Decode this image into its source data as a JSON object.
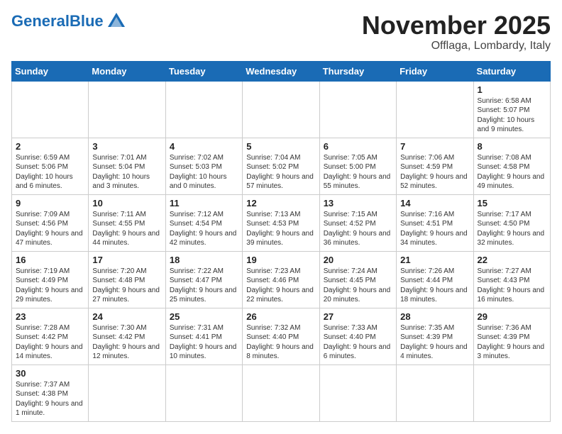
{
  "header": {
    "logo_general": "General",
    "logo_blue": "Blue",
    "month": "November 2025",
    "location": "Offlaga, Lombardy, Italy"
  },
  "days_of_week": [
    "Sunday",
    "Monday",
    "Tuesday",
    "Wednesday",
    "Thursday",
    "Friday",
    "Saturday"
  ],
  "weeks": [
    [
      {
        "day": "",
        "info": ""
      },
      {
        "day": "",
        "info": ""
      },
      {
        "day": "",
        "info": ""
      },
      {
        "day": "",
        "info": ""
      },
      {
        "day": "",
        "info": ""
      },
      {
        "day": "",
        "info": ""
      },
      {
        "day": "1",
        "info": "Sunrise: 6:58 AM\nSunset: 5:07 PM\nDaylight: 10 hours and 9 minutes."
      }
    ],
    [
      {
        "day": "2",
        "info": "Sunrise: 6:59 AM\nSunset: 5:06 PM\nDaylight: 10 hours and 6 minutes."
      },
      {
        "day": "3",
        "info": "Sunrise: 7:01 AM\nSunset: 5:04 PM\nDaylight: 10 hours and 3 minutes."
      },
      {
        "day": "4",
        "info": "Sunrise: 7:02 AM\nSunset: 5:03 PM\nDaylight: 10 hours and 0 minutes."
      },
      {
        "day": "5",
        "info": "Sunrise: 7:04 AM\nSunset: 5:02 PM\nDaylight: 9 hours and 57 minutes."
      },
      {
        "day": "6",
        "info": "Sunrise: 7:05 AM\nSunset: 5:00 PM\nDaylight: 9 hours and 55 minutes."
      },
      {
        "day": "7",
        "info": "Sunrise: 7:06 AM\nSunset: 4:59 PM\nDaylight: 9 hours and 52 minutes."
      },
      {
        "day": "8",
        "info": "Sunrise: 7:08 AM\nSunset: 4:58 PM\nDaylight: 9 hours and 49 minutes."
      }
    ],
    [
      {
        "day": "9",
        "info": "Sunrise: 7:09 AM\nSunset: 4:56 PM\nDaylight: 9 hours and 47 minutes."
      },
      {
        "day": "10",
        "info": "Sunrise: 7:11 AM\nSunset: 4:55 PM\nDaylight: 9 hours and 44 minutes."
      },
      {
        "day": "11",
        "info": "Sunrise: 7:12 AM\nSunset: 4:54 PM\nDaylight: 9 hours and 42 minutes."
      },
      {
        "day": "12",
        "info": "Sunrise: 7:13 AM\nSunset: 4:53 PM\nDaylight: 9 hours and 39 minutes."
      },
      {
        "day": "13",
        "info": "Sunrise: 7:15 AM\nSunset: 4:52 PM\nDaylight: 9 hours and 36 minutes."
      },
      {
        "day": "14",
        "info": "Sunrise: 7:16 AM\nSunset: 4:51 PM\nDaylight: 9 hours and 34 minutes."
      },
      {
        "day": "15",
        "info": "Sunrise: 7:17 AM\nSunset: 4:50 PM\nDaylight: 9 hours and 32 minutes."
      }
    ],
    [
      {
        "day": "16",
        "info": "Sunrise: 7:19 AM\nSunset: 4:49 PM\nDaylight: 9 hours and 29 minutes."
      },
      {
        "day": "17",
        "info": "Sunrise: 7:20 AM\nSunset: 4:48 PM\nDaylight: 9 hours and 27 minutes."
      },
      {
        "day": "18",
        "info": "Sunrise: 7:22 AM\nSunset: 4:47 PM\nDaylight: 9 hours and 25 minutes."
      },
      {
        "day": "19",
        "info": "Sunrise: 7:23 AM\nSunset: 4:46 PM\nDaylight: 9 hours and 22 minutes."
      },
      {
        "day": "20",
        "info": "Sunrise: 7:24 AM\nSunset: 4:45 PM\nDaylight: 9 hours and 20 minutes."
      },
      {
        "day": "21",
        "info": "Sunrise: 7:26 AM\nSunset: 4:44 PM\nDaylight: 9 hours and 18 minutes."
      },
      {
        "day": "22",
        "info": "Sunrise: 7:27 AM\nSunset: 4:43 PM\nDaylight: 9 hours and 16 minutes."
      }
    ],
    [
      {
        "day": "23",
        "info": "Sunrise: 7:28 AM\nSunset: 4:42 PM\nDaylight: 9 hours and 14 minutes."
      },
      {
        "day": "24",
        "info": "Sunrise: 7:30 AM\nSunset: 4:42 PM\nDaylight: 9 hours and 12 minutes."
      },
      {
        "day": "25",
        "info": "Sunrise: 7:31 AM\nSunset: 4:41 PM\nDaylight: 9 hours and 10 minutes."
      },
      {
        "day": "26",
        "info": "Sunrise: 7:32 AM\nSunset: 4:40 PM\nDaylight: 9 hours and 8 minutes."
      },
      {
        "day": "27",
        "info": "Sunrise: 7:33 AM\nSunset: 4:40 PM\nDaylight: 9 hours and 6 minutes."
      },
      {
        "day": "28",
        "info": "Sunrise: 7:35 AM\nSunset: 4:39 PM\nDaylight: 9 hours and 4 minutes."
      },
      {
        "day": "29",
        "info": "Sunrise: 7:36 AM\nSunset: 4:39 PM\nDaylight: 9 hours and 3 minutes."
      }
    ],
    [
      {
        "day": "30",
        "info": "Sunrise: 7:37 AM\nSunset: 4:38 PM\nDaylight: 9 hours and 1 minute."
      },
      {
        "day": "",
        "info": ""
      },
      {
        "day": "",
        "info": ""
      },
      {
        "day": "",
        "info": ""
      },
      {
        "day": "",
        "info": ""
      },
      {
        "day": "",
        "info": ""
      },
      {
        "day": "",
        "info": ""
      }
    ]
  ]
}
